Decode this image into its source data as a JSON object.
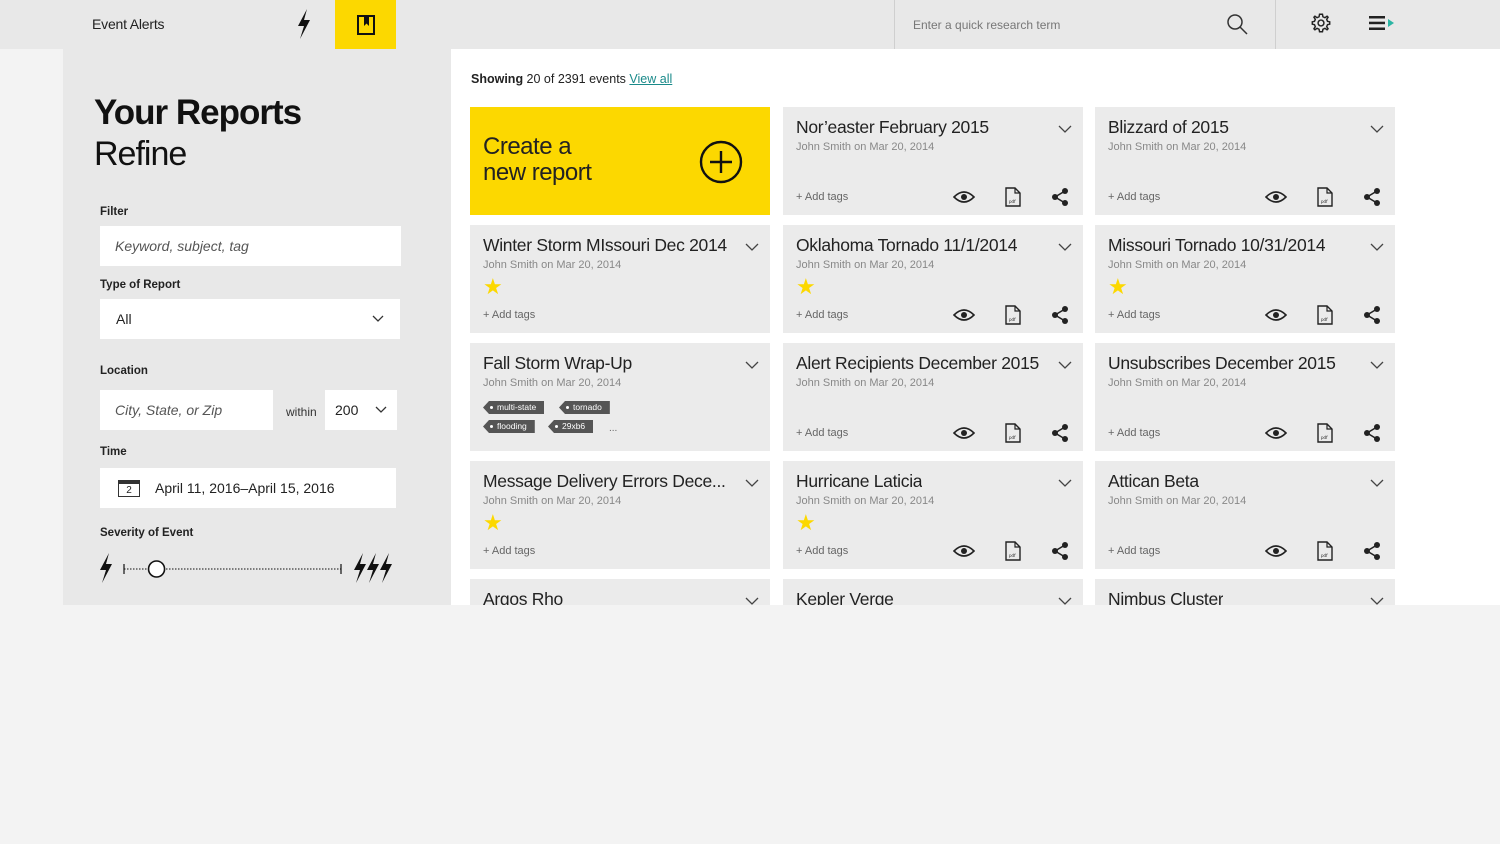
{
  "header": {
    "app_title": "Event Alerts",
    "search_placeholder": "Enter a quick research term"
  },
  "colors": {
    "accent": "#fcd800",
    "link": "#1a8a8a",
    "panel": "#e8e8e8",
    "card": "#ebebeb"
  },
  "icons": {
    "alerts": "lightning-bolt-icon",
    "reports": "bookmark-icon",
    "search": "search-icon",
    "settings": "gear-icon",
    "menu": "menu-icon"
  },
  "sidebar": {
    "title": "Your Reports",
    "subtitle": "Refine",
    "filter_label": "Filter",
    "filter_placeholder": "Keyword, subject, tag",
    "type_label": "Type of Report",
    "type_value": "All",
    "location_label": "Location",
    "location_placeholder": "City, State, or Zip",
    "within_label": "within",
    "within_value": "200",
    "time_label": "Time",
    "calendar_day": "2",
    "time_value": "April 11, 2016–April 15, 2016",
    "severity_label": "Severity of Event",
    "severity_level": 0.15
  },
  "main": {
    "showing_bold": "Showing",
    "showing_text": " 20 of 2391 events ",
    "view_all": "View all",
    "create_line1": "Create a",
    "create_line2": "new report",
    "add_tags": "+ Add tags",
    "cards": [
      {
        "title": "Nor’easter February 2015",
        "meta": "John Smith on Mar 20, 2014",
        "starred": false,
        "actions": true,
        "tags": []
      },
      {
        "title": "Blizzard of 2015",
        "meta": "John Smith on Mar 20, 2014",
        "starred": false,
        "actions": true,
        "tags": []
      },
      {
        "title": "Winter Storm MIssouri Dec 2014",
        "meta": "John Smith on Mar 20, 2014",
        "starred": true,
        "actions": false,
        "tags": []
      },
      {
        "title": "Oklahoma Tornado 11/1/2014",
        "meta": "John Smith on Mar 20, 2014",
        "starred": true,
        "actions": true,
        "tags": []
      },
      {
        "title": "Missouri Tornado 10/31/2014",
        "meta": "John Smith on Mar 20, 2014",
        "starred": true,
        "actions": true,
        "tags": []
      },
      {
        "title": "Fall Storm Wrap-Up",
        "meta": "John Smith on Mar 20, 2014",
        "starred": false,
        "actions": false,
        "tags": [
          "multi-state",
          "tornado",
          "flooding",
          "29xb6"
        ],
        "more": "..."
      },
      {
        "title": "Alert Recipients December 2015",
        "meta": "John Smith on Mar 20, 2014",
        "starred": false,
        "actions": true,
        "tags": []
      },
      {
        "title": "Unsubscribes December 2015",
        "meta": "John Smith on Mar 20, 2014",
        "starred": false,
        "actions": true,
        "tags": []
      },
      {
        "title": "Message Delivery Errors Dece...",
        "meta": "John Smith on Mar 20, 2014",
        "starred": true,
        "actions": false,
        "tags": []
      },
      {
        "title": "Hurricane Laticia",
        "meta": "John Smith on Mar 20, 2014",
        "starred": true,
        "actions": true,
        "tags": []
      },
      {
        "title": "Attican Beta",
        "meta": "John Smith on Mar 20, 2014",
        "starred": false,
        "actions": true,
        "tags": []
      },
      {
        "title": "Argos Rho",
        "meta": "",
        "starred": false,
        "actions": false,
        "tags": []
      },
      {
        "title": "Kepler Verge",
        "meta": "",
        "starred": false,
        "actions": false,
        "tags": []
      },
      {
        "title": "Nimbus Cluster",
        "meta": "",
        "starred": false,
        "actions": false,
        "tags": []
      }
    ]
  }
}
